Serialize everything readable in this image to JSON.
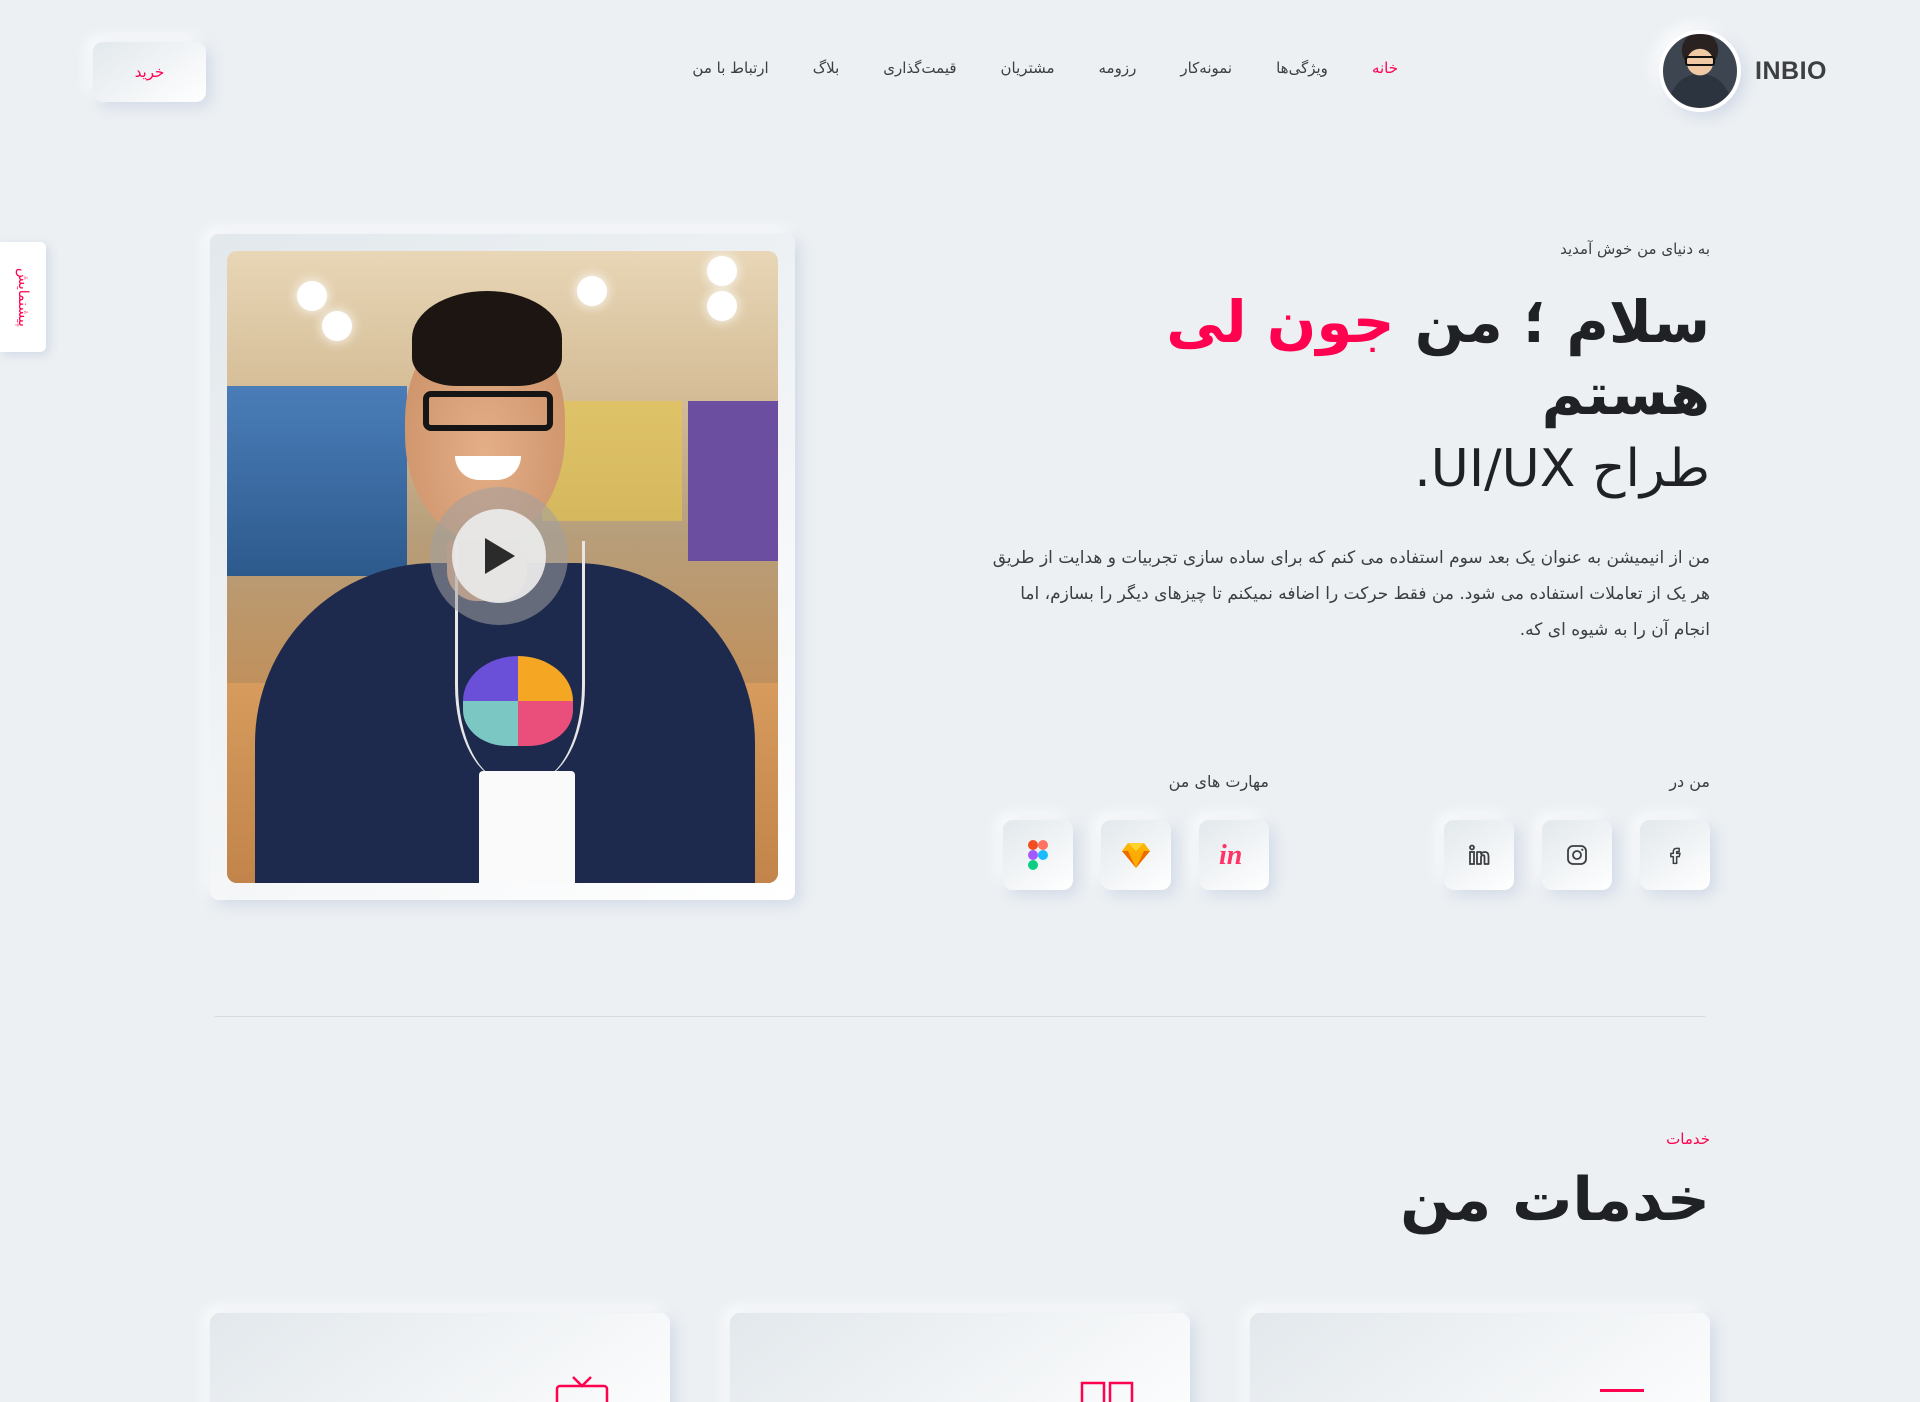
{
  "header": {
    "logo_text": "INBIO",
    "nav": [
      "خانه",
      "ویژگی‌ها",
      "نمونه‌کار",
      "رزومه",
      "مشتریان",
      "قیمت‌گذاری",
      "بلاگ",
      "ارتباط با من"
    ],
    "active_nav": "خانه",
    "buy_label": "خرید"
  },
  "side_tab": {
    "label": "پیشنمایش"
  },
  "hero": {
    "welcome": "به دنیای من خوش آمدید",
    "headline_prefix": "سلام ؛ من",
    "headline_name": "جون لی",
    "headline_suffix": "هستم",
    "subline": "طراح UI/UX.",
    "description": "من از انیمیشن به عنوان یک بعد سوم استفاده می کنم که برای ساده سازی تجربیات و هدایت از طریق هر یک از تعاملات استفاده می شود. من فقط حرکت را اضافه نمیکنم تا چیزهای دیگر را بسازم، اما انجام آن را به شیوه ای که."
  },
  "social": {
    "label": "من در",
    "icons": [
      "facebook-icon",
      "instagram-icon",
      "linkedin-icon"
    ]
  },
  "skills": {
    "label": "مهارت های من",
    "icons": [
      "invision-icon",
      "sketch-icon",
      "figma-icon"
    ]
  },
  "services": {
    "label": "خدمات",
    "title": "خدمات من"
  },
  "colors": {
    "accent": "#ff014f",
    "background": "#ecf0f3",
    "text": "#3c3e41"
  }
}
